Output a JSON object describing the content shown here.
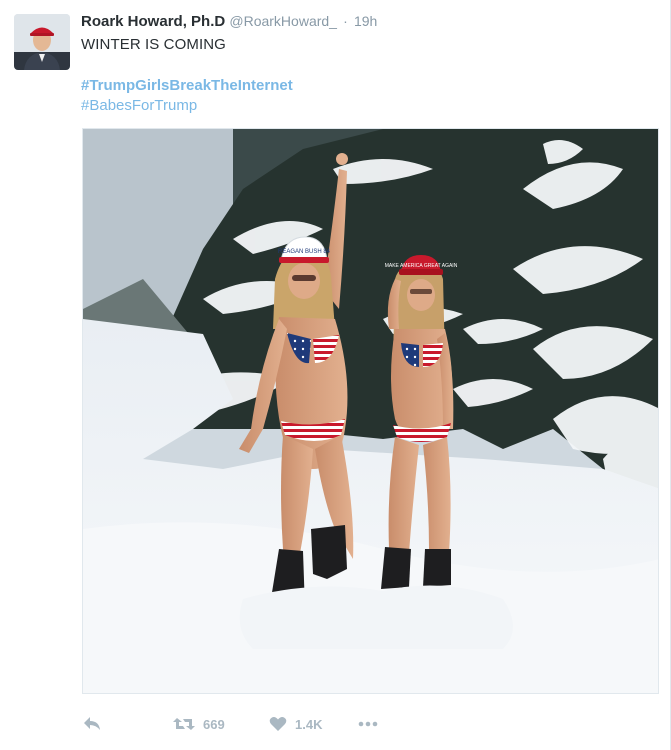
{
  "tweet": {
    "author_name": "Roark Howard, Ph.D",
    "author_handle": "@RoarkHoward_",
    "separator": "·",
    "time": "19h",
    "text": "WINTER IS COMING",
    "hashtags": [
      "#TrumpGirlsBreakTheInternet",
      "#BabesForTrump"
    ]
  },
  "photo": {
    "hat_left_text": "REAGAN BUSH 84",
    "hat_right_text": "MAKE AMERICA GREAT AGAIN"
  },
  "actions": {
    "reply_icon": "reply-icon",
    "retweet_icon": "retweet-icon",
    "retweet_count": "669",
    "like_icon": "heart-icon",
    "like_count": "1.4K",
    "more_icon": "more-icon"
  },
  "colors": {
    "hashtag": "#7ab8e5",
    "meta": "#8899a6",
    "action": "#aab8c2",
    "hat_red": "#c8192c"
  }
}
